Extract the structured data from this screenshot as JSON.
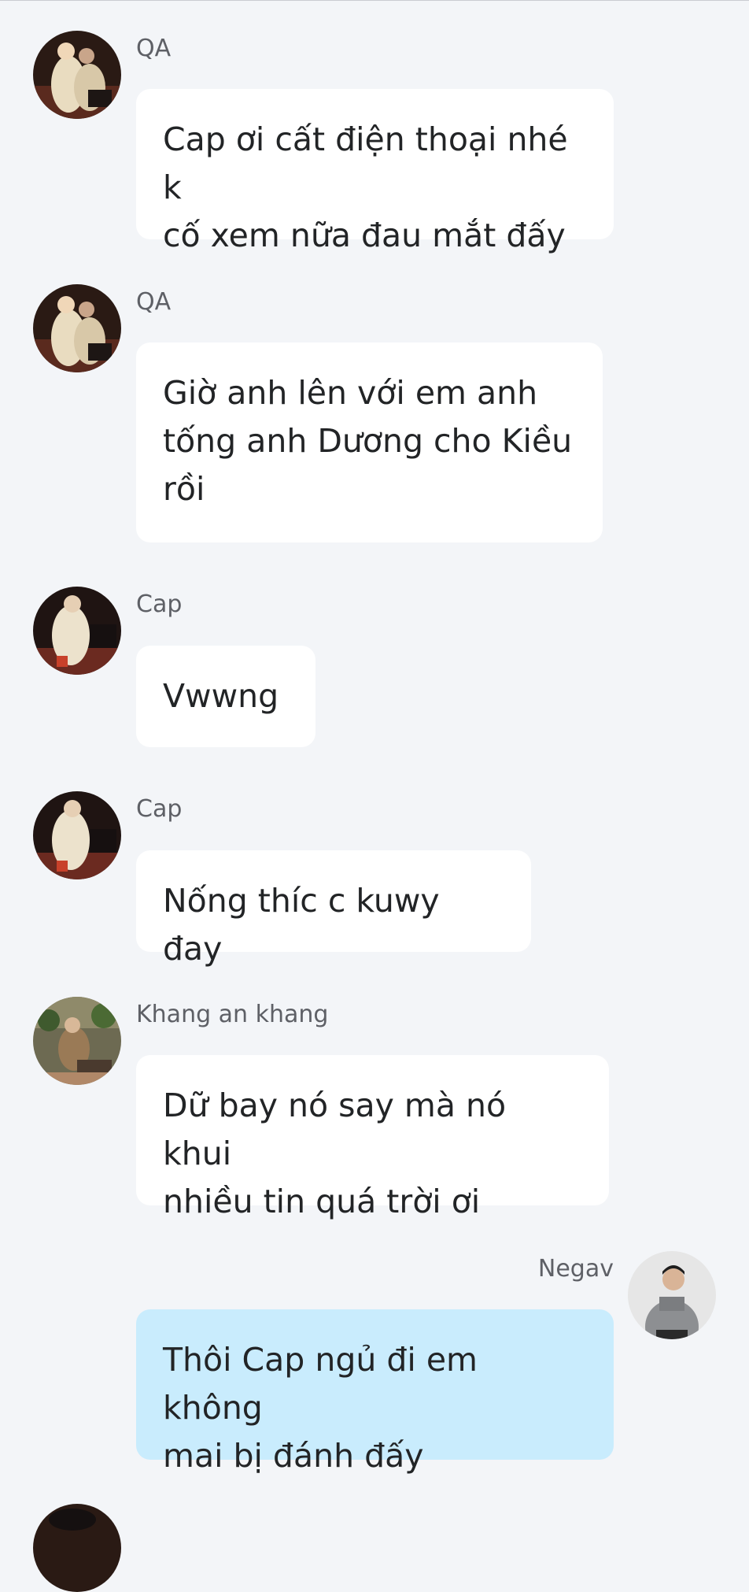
{
  "colors": {
    "background": "#f3f5f8",
    "incoming_bubble": "#ffffff",
    "outgoing_bubble": "#c9ecfd",
    "sender_text": "#5e6066",
    "message_text": "#222426"
  },
  "messages": [
    {
      "sender": "QA",
      "text": "Cap ơi cất điện thoại nhé k\ncố xem nữa đau mắt đấy",
      "avatar": "couple-photo-avatar"
    },
    {
      "sender": "QA",
      "text": "Giờ anh lên với em anh\ntống anh Dương cho Kiều\nrồi",
      "avatar": "couple-photo-avatar"
    },
    {
      "sender": "Cap",
      "text": "Vwwng",
      "avatar": "couple-photo-avatar"
    },
    {
      "sender": "Cap",
      "text": "Nống thíc c kuwy đay",
      "avatar": "couple-photo-avatar"
    },
    {
      "sender": "Khang an khang",
      "text": "Dữ bay nó say mà nó khui\nnhiều tin quá trời ơi",
      "avatar": "man-sitting-avatar"
    },
    {
      "sender": "Negav",
      "text": "Thôi Cap ngủ đi em không\nmai bị đánh đấy",
      "avatar": "man-portrait-avatar",
      "mine": true
    }
  ]
}
